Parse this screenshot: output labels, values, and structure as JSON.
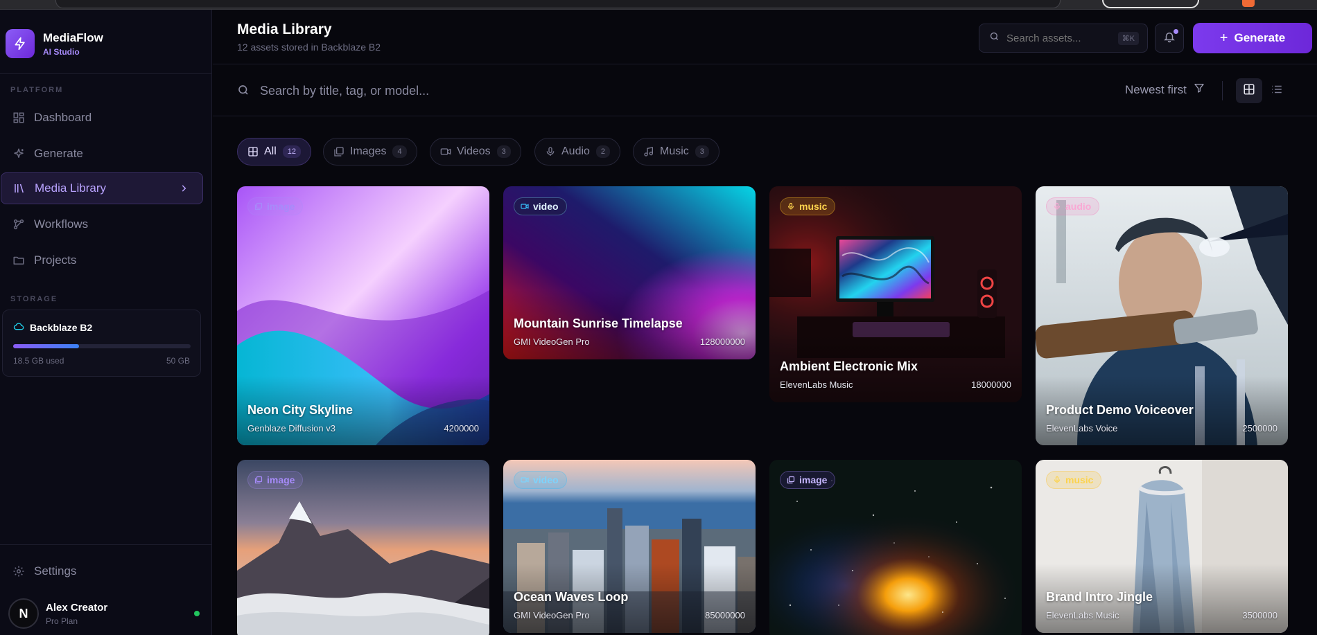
{
  "brand": {
    "name": "MediaFlow",
    "subtitle": "AI Studio"
  },
  "sidebar": {
    "platform_label": "PLATFORM",
    "items": [
      {
        "label": "Dashboard",
        "icon": "dashboard-icon"
      },
      {
        "label": "Generate",
        "icon": "sparkles-icon"
      },
      {
        "label": "Media Library",
        "icon": "library-icon",
        "active": true
      },
      {
        "label": "Workflows",
        "icon": "workflow-icon"
      },
      {
        "label": "Projects",
        "icon": "folder-icon"
      }
    ],
    "storage_label": "STORAGE",
    "storage": {
      "name": "Backblaze B2",
      "used": "18.5 GB used",
      "total": "50 GB",
      "used_fraction": 0.37
    },
    "settings_label": "Settings",
    "user": {
      "initial": "N",
      "name": "Alex Creator",
      "plan": "Pro Plan"
    }
  },
  "header": {
    "title": "Media Library",
    "subtitle": "12 assets stored in Backblaze B2",
    "search_placeholder": "Search assets...",
    "shortcut": "⌘K",
    "generate_label": "Generate"
  },
  "toolbar": {
    "search_placeholder": "Search by title, tag, or model...",
    "sort_label": "Newest first"
  },
  "filters": [
    {
      "label": "All",
      "count": "12",
      "active": true
    },
    {
      "label": "Images",
      "count": "4"
    },
    {
      "label": "Videos",
      "count": "3"
    },
    {
      "label": "Audio",
      "count": "2"
    },
    {
      "label": "Music",
      "count": "3"
    }
  ],
  "cards": [
    {
      "type": "image",
      "title": "Neon City Skyline",
      "model": "Genblaze Diffusion v3",
      "size": "4200000"
    },
    {
      "type": "video",
      "title": "Mountain Sunrise Timelapse",
      "model": "GMI VideoGen Pro",
      "size": "128000000"
    },
    {
      "type": "music",
      "title": "Ambient Electronic Mix",
      "model": "ElevenLabs Music",
      "size": "18000000"
    },
    {
      "type": "audio",
      "title": "Product Demo Voiceover",
      "model": "ElevenLabs Voice",
      "size": "2500000"
    },
    {
      "type": "image",
      "title": "",
      "model": "",
      "size": ""
    },
    {
      "type": "video",
      "title": "Ocean Waves Loop",
      "model": "GMI VideoGen Pro",
      "size": "85000000"
    },
    {
      "type": "image",
      "title": "",
      "model": "",
      "size": ""
    },
    {
      "type": "music",
      "title": "Brand Intro Jingle",
      "model": "ElevenLabs Music",
      "size": "3500000"
    }
  ],
  "colors": {
    "accent": "#7c3aed",
    "active_text": "#b9a3ff",
    "online": "#22c55e"
  }
}
